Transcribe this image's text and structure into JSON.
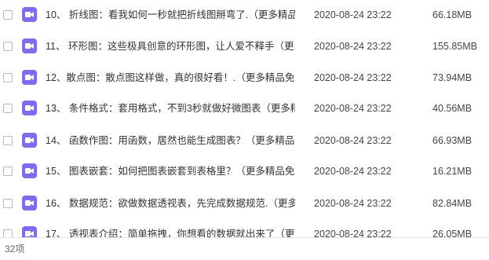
{
  "files": [
    {
      "name": "10、 折线图：看我如何一秒就把折线图掰弯了.（更多精品...",
      "date": "2020-08-24 23:22",
      "size": "66.18MB"
    },
    {
      "name": "11、 环形图：这些极具创意的环形图，让人爱不释手（更...",
      "date": "2020-08-24 23:22",
      "size": "155.85MB"
    },
    {
      "name": "12、散点图：散点图这样做，真的很好看！.（更多精品免...",
      "date": "2020-08-24 23:22",
      "size": "73.94MB"
    },
    {
      "name": "13、 条件格式：套用格式，不到3秒就做好微图表（更多精...",
      "date": "2020-08-24 23:22",
      "size": "40.56MB"
    },
    {
      "name": "14、 函数作图：用函数，居然也能生成图表？（更多精品...",
      "date": "2020-08-24 23:22",
      "size": "66.93MB"
    },
    {
      "name": "15、 图表嵌套：如何把图表嵌套到表格里？（更多精品免...",
      "date": "2020-08-24 23:22",
      "size": "16.21MB"
    },
    {
      "name": "16、 数据规范：欲做数据透视表，先完成数据规范.（更多...",
      "date": "2020-08-24 23:22",
      "size": "82.84MB"
    },
    {
      "name": "17、 透视表介绍：简单拖拽，你想看的数据就出来了（更多...",
      "date": "2020-08-24 23:22",
      "size": "26.05MB"
    }
  ],
  "footer": {
    "count": "32项"
  },
  "colors": {
    "video_icon": "#7c6cf0"
  },
  "icons": {
    "file_type": "video-file-icon"
  }
}
